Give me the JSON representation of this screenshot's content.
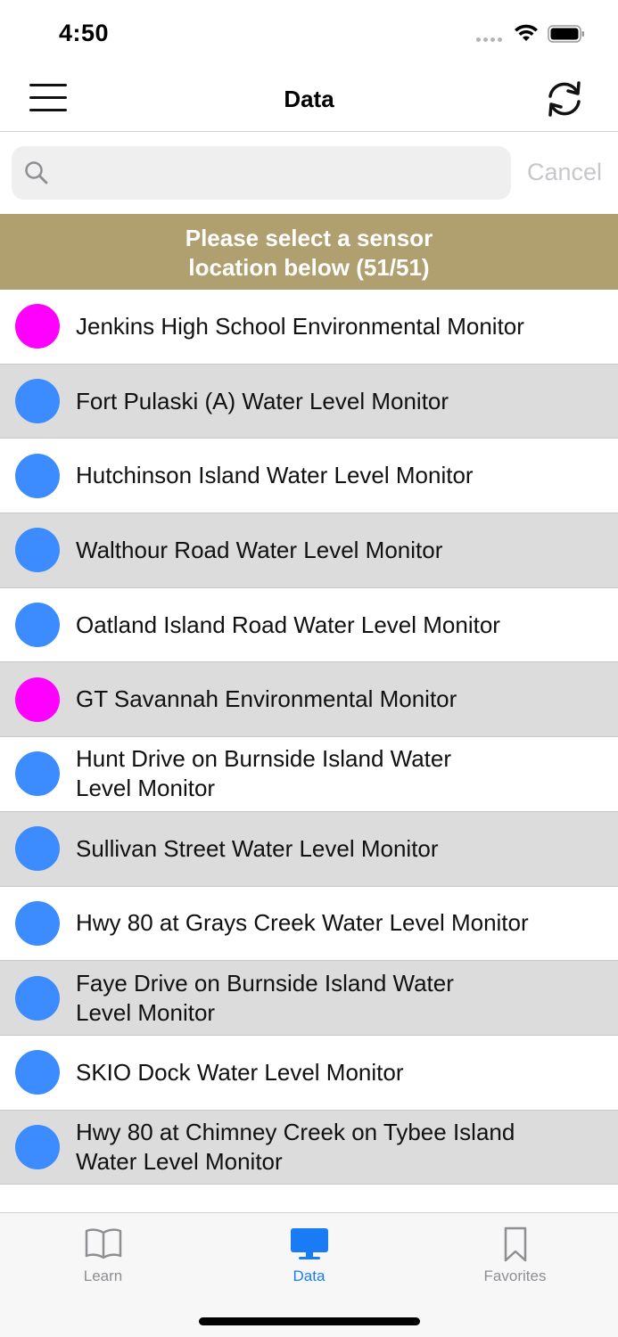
{
  "status_bar": {
    "time": "4:50"
  },
  "nav": {
    "title": "Data",
    "menu_icon": "hamburger-menu-icon",
    "refresh_icon": "refresh-icon"
  },
  "search": {
    "value": "",
    "placeholder": "",
    "cancel_label": "Cancel"
  },
  "banner": {
    "line1": "Please select a sensor",
    "line2": "location below (51/51)",
    "color": "#b0a070"
  },
  "colors": {
    "environmental": "#ff00ff",
    "water_level": "#3c8cff",
    "accent": "#1a7cf5"
  },
  "sensors": [
    {
      "label_line1": "Jenkins High School Environmental Monitor",
      "label_line2": "",
      "type": "env"
    },
    {
      "label_line1": "Fort Pulaski (A) Water Level Monitor",
      "label_line2": "",
      "type": "water"
    },
    {
      "label_line1": "Hutchinson Island Water Level Monitor",
      "label_line2": "",
      "type": "water"
    },
    {
      "label_line1": "Walthour Road Water Level Monitor",
      "label_line2": "",
      "type": "water"
    },
    {
      "label_line1": "Oatland Island Road Water Level Monitor",
      "label_line2": "",
      "type": "water"
    },
    {
      "label_line1": "GT Savannah Environmental Monitor",
      "label_line2": "",
      "type": "env"
    },
    {
      "label_line1": "Hunt Drive on Burnside Island Water",
      "label_line2": "Level Monitor",
      "type": "water"
    },
    {
      "label_line1": "Sullivan Street Water Level Monitor",
      "label_line2": "",
      "type": "water"
    },
    {
      "label_line1": "Hwy 80 at Grays Creek Water Level Monitor",
      "label_line2": "",
      "type": "water"
    },
    {
      "label_line1": "Faye Drive on Burnside Island Water",
      "label_line2": "Level Monitor",
      "type": "water"
    },
    {
      "label_line1": "SKIO Dock Water Level Monitor",
      "label_line2": "",
      "type": "water"
    },
    {
      "label_line1": "Hwy 80 at Chimney Creek on Tybee Island",
      "label_line2": "Water Level Monitor",
      "type": "water"
    }
  ],
  "tabs": [
    {
      "label": "Learn",
      "icon": "book-icon",
      "active": false
    },
    {
      "label": "Data",
      "icon": "monitor-icon",
      "active": true
    },
    {
      "label": "Favorites",
      "icon": "bookmark-icon",
      "active": false
    }
  ]
}
